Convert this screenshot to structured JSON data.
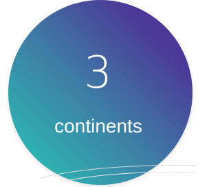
{
  "stat": {
    "value": "3",
    "label": "continents"
  },
  "colors": {
    "gradient_start": "#27c9b6",
    "gradient_end": "#5a2a93",
    "text": "#ffffff"
  }
}
